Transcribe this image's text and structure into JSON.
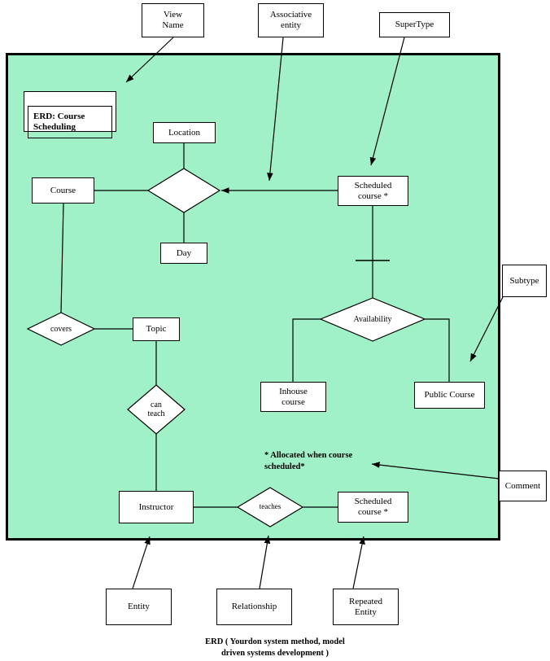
{
  "diagram": {
    "title_box": {
      "label": "ERD: Course\nScheduling"
    },
    "caption": "ERD ( Yourdon system method, model\ndriven systems development )",
    "note": "* Allocated when course\nscheduled*",
    "canvas_color": "#a0f0c8",
    "entities": [
      {
        "id": "course",
        "label": "Course"
      },
      {
        "id": "location",
        "label": "Location"
      },
      {
        "id": "day",
        "label": "Day"
      },
      {
        "id": "scheduled-course-top",
        "label": "Scheduled\ncourse  *"
      },
      {
        "id": "topic",
        "label": "Topic"
      },
      {
        "id": "inhouse-course",
        "label": "Inhouse\ncourse"
      },
      {
        "id": "public-course",
        "label": "Public Course"
      },
      {
        "id": "instructor",
        "label": "Instructor"
      },
      {
        "id": "scheduled-course-bottom",
        "label": "Scheduled\ncourse  *"
      }
    ],
    "relationships": [
      {
        "id": "schedule",
        "label": ""
      },
      {
        "id": "covers",
        "label": "covers"
      },
      {
        "id": "can-teach",
        "label": "can\nteach"
      },
      {
        "id": "availability",
        "label": "Availability"
      },
      {
        "id": "teaches",
        "label": "teaches"
      }
    ],
    "annotations": [
      {
        "id": "view-name",
        "label": "View\nName"
      },
      {
        "id": "associative-entity",
        "label": "Associative\nentity"
      },
      {
        "id": "supertype",
        "label": "SuperType"
      },
      {
        "id": "subtype",
        "label": "Subtype"
      },
      {
        "id": "comment",
        "label": "Comment"
      },
      {
        "id": "entity",
        "label": "Entity"
      },
      {
        "id": "relationship",
        "label": "Relationship"
      },
      {
        "id": "repeated-entity",
        "label": "Repeated\nEntity"
      }
    ]
  }
}
